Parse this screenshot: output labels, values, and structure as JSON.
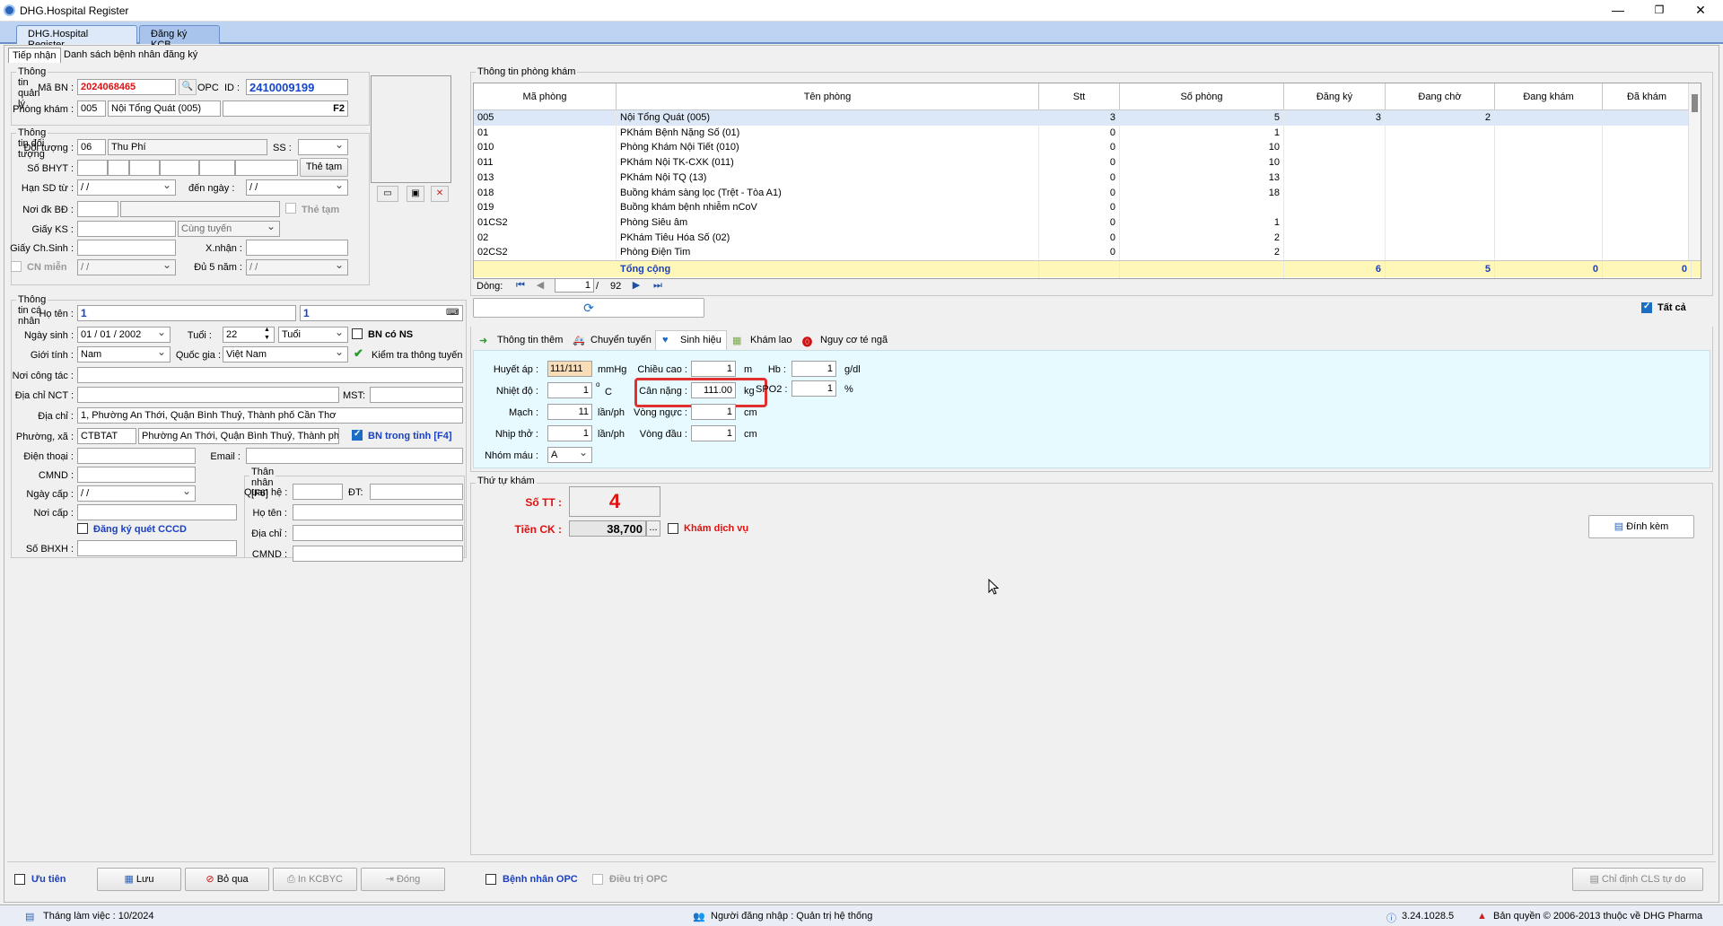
{
  "window": {
    "title": "DHG.Hospital Register",
    "min": "—",
    "max": "❐",
    "close": "✕"
  },
  "doc_tabs": [
    "DHG.Hospital Register",
    "Đăng ký KCB"
  ],
  "sub_tabs": [
    "Tiếp nhận",
    "Danh sách bệnh nhân đăng ký"
  ],
  "quan_ly": {
    "group": "Thông tin quản lý",
    "ma_bn_label": "Mã BN :",
    "ma_bn": "2024068465",
    "opc": "OPC",
    "id_label": "ID :",
    "id": "2410009199",
    "phong_kham_label": "Phòng khám :",
    "phong_code": "005",
    "phong_name": "Nội Tổng Quát (005)",
    "f2": "F2"
  },
  "doi_tuong": {
    "group": "Thông tin đối tượng",
    "doi_tuong_label": "Đối tượng :",
    "dt_code": "06",
    "dt_name": "Thu Phí",
    "ss_label": "SS :",
    "so_bhyt_label": "Số BHYT :",
    "the_tam_btn": "Thẻ tạm",
    "han_sd_label": "Hạn SD từ :",
    "han_tu": "  /    /",
    "den_ngay_label": "đến ngày :",
    "han_den": "  /    /",
    "noi_dk_label": "Nơi đk BĐ :",
    "the_tam_chk": "Thẻ tạm",
    "giay_ks_label": "Giấy KS :",
    "cung_tuyen": "Cùng tuyến",
    "giay_chsinh_label": "Giấy Ch.Sinh :",
    "xnhan_label": "X.nhận :",
    "cn_mien_label": "CN miễn",
    "cn_mien_date": "  /    /",
    "du5nam_label": "Đủ 5 năm :",
    "du5nam_date": "  /    /"
  },
  "ca_nhan": {
    "group": "Thông tin cá nhân",
    "ho_ten_label": "Họ tên :",
    "ho_ten": "1",
    "ho_ten2": "1",
    "ngay_sinh_label": "Ngày sinh :",
    "ngay_sinh": "01 / 01 / 2002",
    "tuoi_label": "Tuổi :",
    "tuoi": "22",
    "tuoi_unit": "Tuổi",
    "bn_co_ns": "BN có NS",
    "gioi_tinh_label": "Giới tính :",
    "gioi_tinh": "Nam",
    "quoc_gia_label": "Quốc gia :",
    "quoc_gia": "Việt Nam",
    "kiem_tra": "Kiểm tra thông tuyến",
    "noi_cong_tac_label": "Nơi công tác :",
    "dia_chi_nct_label": "Địa chỉ  NCT :",
    "mst_label": "MST:",
    "dia_chi_label": "Địa chỉ :",
    "dia_chi": "1, Phường An Thới, Quận Bình Thuỷ, Thành phố Cần Thơ",
    "phuong_xa_label": "Phường, xã :",
    "px_code": "CTBTAT",
    "px_name": "Phường An Thới, Quận Bình Thuỷ, Thành phố",
    "bn_trong_tinh": "BN trong tỉnh [F4]",
    "dien_thoai_label": "Điện thoại :",
    "email_label": "Email :",
    "cmnd_label": "CMND :",
    "ngay_cap_label": "Ngày cấp :",
    "ngay_cap": "  /    /",
    "noi_cap_label": "Nơi cấp :",
    "dk_cccd": "Đăng ký quét CCCD",
    "so_bhxh_label": "Số BHXH :",
    "than_nhan": {
      "group": "Thân nhân [F6]",
      "quan_he": "Quan hệ :",
      "dt": "ĐT:",
      "ho_ten": "Họ tên :",
      "dia_chi": "Địa chỉ :",
      "cmnd": "CMND :"
    }
  },
  "phong_kham": {
    "group": "Thông tin phòng khám",
    "columns": [
      "Mã phòng",
      "Tên phòng",
      "Stt",
      "Số phòng",
      "Đăng ký",
      "Đang chờ",
      "Đang khám",
      "Đã khám"
    ],
    "rows": [
      [
        "005",
        "Nội Tổng Quát (005)",
        "3",
        "5",
        "3",
        "2",
        "",
        ""
      ],
      [
        "01",
        "PKhám Bệnh Nặng Số (01)",
        "0",
        "1",
        "",
        "",
        "",
        ""
      ],
      [
        "010",
        "Phòng Khám Nội Tiết (010)",
        "0",
        "10",
        "",
        "",
        "",
        ""
      ],
      [
        "011",
        "PKhám Nội TK-CXK (011)",
        "0",
        "10",
        "",
        "",
        "",
        ""
      ],
      [
        "013",
        "PKhám Nội TQ (13)",
        "0",
        "13",
        "",
        "",
        "",
        ""
      ],
      [
        "018",
        "Buồng khám sàng lọc (Trệt - Tòa A1)",
        "0",
        "18",
        "",
        "",
        "",
        ""
      ],
      [
        "019",
        "Buồng khám bệnh nhiễm nCoV",
        "0",
        "",
        "",
        "",
        "",
        ""
      ],
      [
        "01CS2",
        "Phòng Siêu âm",
        "0",
        "1",
        "",
        "",
        "",
        ""
      ],
      [
        "02",
        "PKhám Tiêu Hóa Số (02)",
        "0",
        "2",
        "",
        "",
        "",
        ""
      ],
      [
        "02CS2",
        "Phòng Điện Tim",
        "0",
        "2",
        "",
        "",
        "",
        ""
      ]
    ],
    "total_label": "Tổng cộng",
    "total": [
      "6",
      "5",
      "0",
      "0"
    ],
    "dong_label": "Dòng:",
    "dong_current": "1",
    "dong_sep": "/",
    "dong_total": "92",
    "tat_ca": "Tất cả"
  },
  "tabs2": [
    "Thông tin thêm",
    "Chuyển tuyến",
    "Sinh hiệu",
    "Khám lao",
    "Nguy cơ té ngã"
  ],
  "sinh_hieu": {
    "huyet_ap_label": "Huyết áp :",
    "huyet_ap": "111/111",
    "mmhg": "mmHg",
    "chieu_cao_label": "Chiều cao :",
    "chieu_cao": "1",
    "m": "m",
    "hb_label": "Hb :",
    "hb": "1",
    "gdl": "g/dl",
    "nhiet_do_label": "Nhiệt độ :",
    "nhiet_do": "1",
    "deg": "o",
    "c": "C",
    "can_nang_label": "Cân nặng :",
    "can_nang": "111.00",
    "kg": "kg",
    "spo2_label": "SPO2 :",
    "spo2": "1",
    "pct": "%",
    "mach_label": "Mạch :",
    "mach": "11",
    "lanph1": "lần/ph",
    "vong_nguc_label": "Vòng ngực :",
    "vong_nguc": "1",
    "cm1": "cm",
    "nhip_tho_label": "Nhịp thở :",
    "nhip_tho": "1",
    "lanph2": "lần/ph",
    "vong_dau_label": "Vòng đầu :",
    "vong_dau": "1",
    "cm2": "cm",
    "nhom_mau_label": "Nhóm máu :",
    "nhom_mau": "A"
  },
  "thu_tu": {
    "group": "Thứ tự khám",
    "so_tt_label": "Số TT :",
    "so_tt": "4",
    "tien_ck_label": "Tiền CK :",
    "tien_ck": "38,700",
    "ellipsis": "...",
    "kham_dv": "Khám dịch vụ",
    "dinh_kem": "Đính kèm"
  },
  "bottom": {
    "uu_tien": "Ưu tiên",
    "luu": "Lưu",
    "bo_qua": "Bỏ qua",
    "in_kcbyc": "In KCBYC",
    "dong": "Đóng",
    "bn_opc": "Bệnh nhân OPC",
    "dieu_tri_opc": "Điều trị OPC",
    "chi_dinh": "Chỉ định CLS tự do"
  },
  "status": {
    "thang": "Tháng làm việc : 10/2024",
    "nguoi": "Người đăng nhập : Quản trị hệ thống",
    "version": "3.24.1028.5",
    "ban_quyen": "Bản quyền © 2006-2013 thuộc về DHG Pharma"
  },
  "colors": {
    "accent_red": "#e01010",
    "accent_blue": "#1a3fc2",
    "highlight_box": "#e03030"
  }
}
